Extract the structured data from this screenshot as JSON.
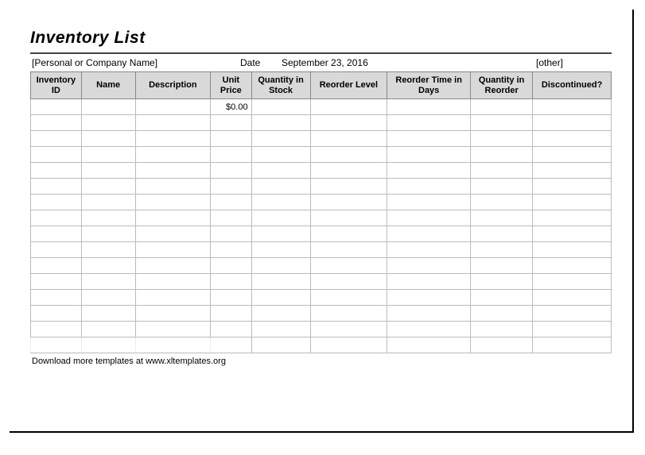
{
  "title": "Inventory List",
  "info": {
    "company_placeholder": "[Personal or Company Name]",
    "date_label": "Date",
    "date_value": "September 23, 2016",
    "other_placeholder": "[other]"
  },
  "columns": {
    "inventory_id": "Inventory ID",
    "name": "Name",
    "description": "Description",
    "unit_price": "Unit Price",
    "qty_stock": "Quantity in Stock",
    "reorder_level": "Reorder Level",
    "reorder_time": "Reorder Time in Days",
    "qty_reorder": "Quantity in Reorder",
    "discontinued": "Discontinued?"
  },
  "rows": [
    {
      "inventory_id": "",
      "name": "",
      "description": "",
      "unit_price": "$0.00",
      "qty_stock": "",
      "reorder_level": "",
      "reorder_time": "",
      "qty_reorder": "",
      "discontinued": ""
    },
    {
      "inventory_id": "",
      "name": "",
      "description": "",
      "unit_price": "",
      "qty_stock": "",
      "reorder_level": "",
      "reorder_time": "",
      "qty_reorder": "",
      "discontinued": ""
    },
    {
      "inventory_id": "",
      "name": "",
      "description": "",
      "unit_price": "",
      "qty_stock": "",
      "reorder_level": "",
      "reorder_time": "",
      "qty_reorder": "",
      "discontinued": ""
    },
    {
      "inventory_id": "",
      "name": "",
      "description": "",
      "unit_price": "",
      "qty_stock": "",
      "reorder_level": "",
      "reorder_time": "",
      "qty_reorder": "",
      "discontinued": ""
    },
    {
      "inventory_id": "",
      "name": "",
      "description": "",
      "unit_price": "",
      "qty_stock": "",
      "reorder_level": "",
      "reorder_time": "",
      "qty_reorder": "",
      "discontinued": ""
    },
    {
      "inventory_id": "",
      "name": "",
      "description": "",
      "unit_price": "",
      "qty_stock": "",
      "reorder_level": "",
      "reorder_time": "",
      "qty_reorder": "",
      "discontinued": ""
    },
    {
      "inventory_id": "",
      "name": "",
      "description": "",
      "unit_price": "",
      "qty_stock": "",
      "reorder_level": "",
      "reorder_time": "",
      "qty_reorder": "",
      "discontinued": ""
    },
    {
      "inventory_id": "",
      "name": "",
      "description": "",
      "unit_price": "",
      "qty_stock": "",
      "reorder_level": "",
      "reorder_time": "",
      "qty_reorder": "",
      "discontinued": ""
    },
    {
      "inventory_id": "",
      "name": "",
      "description": "",
      "unit_price": "",
      "qty_stock": "",
      "reorder_level": "",
      "reorder_time": "",
      "qty_reorder": "",
      "discontinued": ""
    },
    {
      "inventory_id": "",
      "name": "",
      "description": "",
      "unit_price": "",
      "qty_stock": "",
      "reorder_level": "",
      "reorder_time": "",
      "qty_reorder": "",
      "discontinued": ""
    },
    {
      "inventory_id": "",
      "name": "",
      "description": "",
      "unit_price": "",
      "qty_stock": "",
      "reorder_level": "",
      "reorder_time": "",
      "qty_reorder": "",
      "discontinued": ""
    },
    {
      "inventory_id": "",
      "name": "",
      "description": "",
      "unit_price": "",
      "qty_stock": "",
      "reorder_level": "",
      "reorder_time": "",
      "qty_reorder": "",
      "discontinued": ""
    },
    {
      "inventory_id": "",
      "name": "",
      "description": "",
      "unit_price": "",
      "qty_stock": "",
      "reorder_level": "",
      "reorder_time": "",
      "qty_reorder": "",
      "discontinued": ""
    },
    {
      "inventory_id": "",
      "name": "",
      "description": "",
      "unit_price": "",
      "qty_stock": "",
      "reorder_level": "",
      "reorder_time": "",
      "qty_reorder": "",
      "discontinued": ""
    },
    {
      "inventory_id": "",
      "name": "",
      "description": "",
      "unit_price": "",
      "qty_stock": "",
      "reorder_level": "",
      "reorder_time": "",
      "qty_reorder": "",
      "discontinued": ""
    },
    {
      "inventory_id": "",
      "name": "",
      "description": "",
      "unit_price": "",
      "qty_stock": "",
      "reorder_level": "",
      "reorder_time": "",
      "qty_reorder": "",
      "discontinued": ""
    }
  ],
  "footer_text": "Download more templates at www.xltemplates.org"
}
